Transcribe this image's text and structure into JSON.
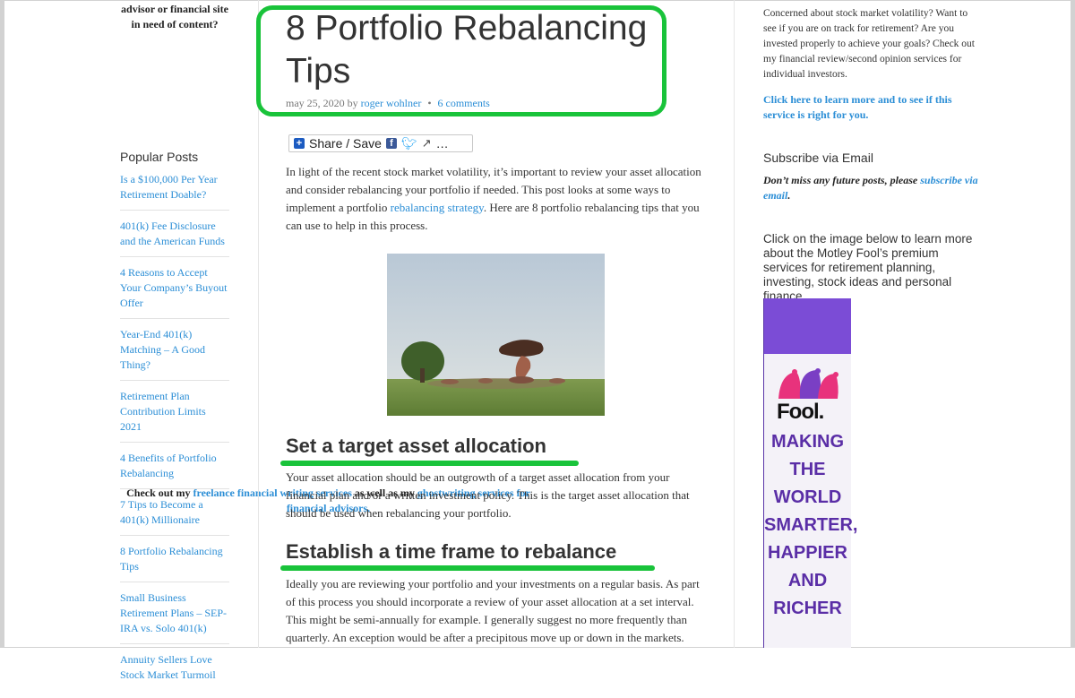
{
  "left_sidebar": {
    "promo_line1": "advisor or financial site in need of content?",
    "promo_check": "Check out my ",
    "promo_link1": "freelance financial writing services",
    "promo_mid": " as well as my ",
    "promo_link2": "ghostwriting services for financial advisors.",
    "popular_title": "Popular Posts",
    "popular_posts": [
      "Is a $100,000 Per Year Retirement Doable?",
      "401(k) Fee Disclosure and the American Funds",
      "4 Reasons to Accept Your Company’s Buyout Offer",
      "Year-End 401(k) Matching – A Good Thing?",
      "Retirement Plan Contribution Limits 2021",
      "4 Benefits of Portfolio Rebalancing",
      "7 Tips to Become a 401(k) Millionaire",
      "8 Portfolio Rebalancing Tips",
      "Small Business Retirement Plans – SEP-IRA vs. Solo 401(k)",
      "Annuity Sellers Love Stock Market Turmoil"
    ]
  },
  "article": {
    "title": "8 Portfolio Rebalancing Tips",
    "date": "may 25, 2020",
    "by": "by",
    "author": "roger wohlner",
    "separator": "•",
    "comments": "6 comments",
    "share_label": "Share / Save",
    "share_more": "…",
    "intro_before": "In light of the recent stock market volatility, it’s important to review your asset allocation and consider rebalancing your portfolio if needed. This post looks at some ways to implement a portfolio ",
    "intro_link": "rebalancing strategy",
    "intro_after": ". Here are 8 portfolio rebalancing tips that you can use to help in this process.",
    "heading1": "Set a target asset allocation",
    "para1": "Your asset allocation should be an outgrowth of a target asset allocation from your financial plan and/or a written investment policy. This is the target asset allocation that should be used when rebalancing your portfolio.",
    "heading2": "Establish a time frame to rebalance",
    "para2": "Ideally you are reviewing your portfolio and your investments on a regular basis. As part of this process you should incorporate a review of your asset allocation at a set interval. This might be semi-annually for example. I generally suggest no more frequently than quarterly. An exception would be after a precipitous move up or down in the markets."
  },
  "right_sidebar": {
    "review_text": "Concerned about stock market volatility? Want to see if you are on track for retirement? Are you invested properly to achieve your goals? Check out my financial review/second opinion services for individual investors.",
    "review_link": "Click here to learn more and to see if this service is right for you.",
    "subscribe_title": "Subscribe via Email",
    "subscribe_text": "Don’t miss any future posts, please ",
    "subscribe_link": "subscribe via email",
    "subscribe_end": ".",
    "fool_text": "Click on the image below to learn more about the Motley Fool’s premium services for retirement planning, investing, stock ideas and personal finance.",
    "banner_brand": "Fool.",
    "banner_slogan": [
      "MAKING",
      "THE",
      "WORLD",
      "SMARTER,",
      "HAPPIER",
      "AND",
      "RICHER"
    ]
  },
  "colors": {
    "highlight": "#19c33a",
    "link": "#2b8ed6",
    "banner_purple": "#5a2ea6"
  }
}
